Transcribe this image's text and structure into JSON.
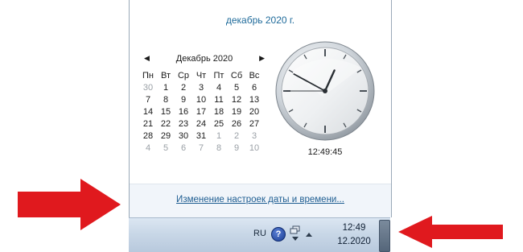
{
  "popup": {
    "header_date": "декабрь 2020 г.",
    "calendar": {
      "month_label": "Декабрь 2020",
      "weekdays": [
        "Пн",
        "Вт",
        "Ср",
        "Чт",
        "Пт",
        "Сб",
        "Вс"
      ],
      "weeks": [
        [
          "30",
          "1",
          "2",
          "3",
          "4",
          "5",
          "6"
        ],
        [
          "7",
          "8",
          "9",
          "10",
          "11",
          "12",
          "13"
        ],
        [
          "14",
          "15",
          "16",
          "17",
          "18",
          "19",
          "20"
        ],
        [
          "21",
          "22",
          "23",
          "24",
          "25",
          "26",
          "27"
        ],
        [
          "28",
          "29",
          "30",
          "31",
          "1",
          "2",
          "3"
        ],
        [
          "4",
          "5",
          "6",
          "7",
          "8",
          "9",
          "10"
        ]
      ],
      "muted": [
        [
          true,
          false,
          false,
          false,
          false,
          false,
          false
        ],
        [
          false,
          false,
          false,
          false,
          false,
          false,
          false
        ],
        [
          false,
          false,
          false,
          false,
          false,
          false,
          false
        ],
        [
          false,
          false,
          false,
          false,
          false,
          false,
          false
        ],
        [
          false,
          false,
          false,
          false,
          true,
          true,
          true
        ],
        [
          true,
          true,
          true,
          true,
          true,
          true,
          true
        ]
      ]
    },
    "clock": {
      "digital_time": "12:49:45",
      "hours": 12,
      "minutes": 49,
      "seconds": 45
    },
    "settings_link": "Изменение настроек даты и времени..."
  },
  "taskbar": {
    "language": "RU",
    "help_glyph": "?",
    "time": "12:49",
    "date": "12.2020",
    "icons": [
      "help-icon",
      "network-icon",
      "show-hidden-icons-icon",
      "show-desktop-button"
    ]
  },
  "colors": {
    "arrow": "#e0191e",
    "link": "#1f5e92",
    "header": "#1e6a9a"
  }
}
